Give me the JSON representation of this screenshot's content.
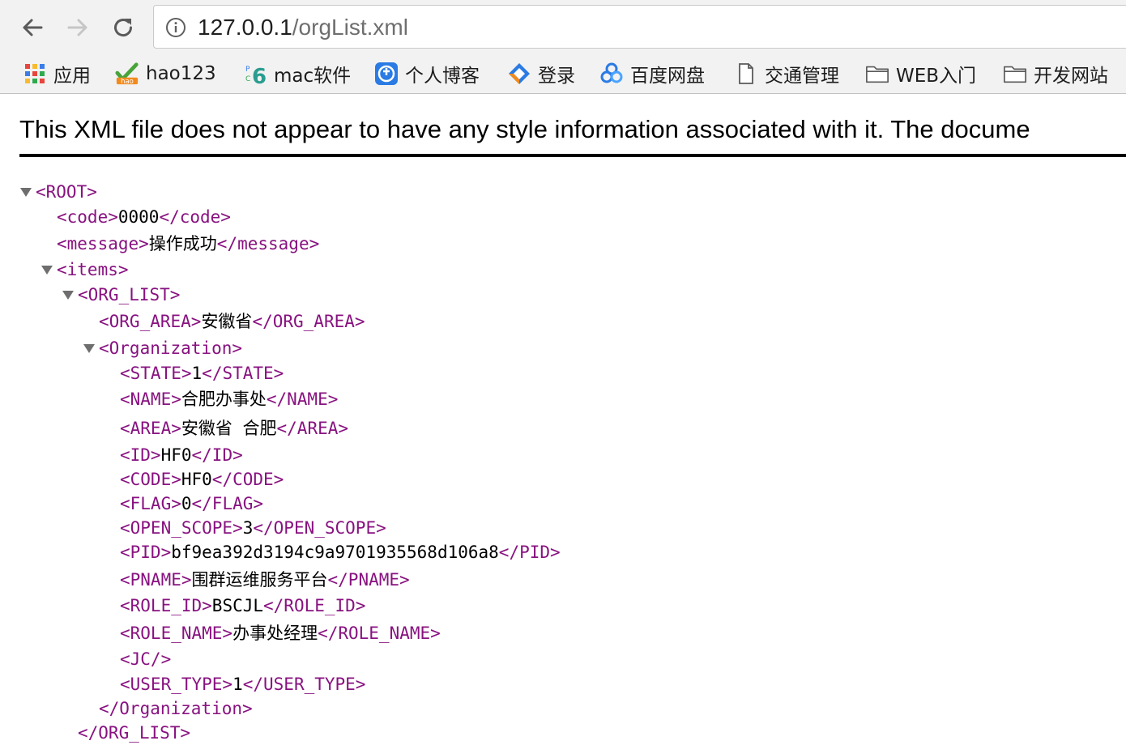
{
  "toolbar": {
    "back_icon": "arrow-left-icon",
    "forward_icon": "arrow-right-icon",
    "reload_icon": "reload-icon",
    "info_icon": "info-circle-icon",
    "url_host": "127.0.0.1",
    "url_path": "/orgList.xml"
  },
  "bookmarks": [
    {
      "label": "应用",
      "icon": "apps-grid-icon"
    },
    {
      "label": "hao123",
      "icon": "hao123-icon"
    },
    {
      "label": "mac软件",
      "icon": "mac-software-icon"
    },
    {
      "label": "个人博客",
      "icon": "blog-icon"
    },
    {
      "label": "登录",
      "icon": "login-icon"
    },
    {
      "label": "百度网盘",
      "icon": "baidu-pan-icon"
    },
    {
      "label": "交通管理",
      "icon": "document-icon"
    },
    {
      "label": "WEB入门",
      "icon": "folder-icon"
    },
    {
      "label": "开发网站",
      "icon": "folder-icon"
    }
  ],
  "notice": "This XML file does not appear to have any style information associated with it. The docume",
  "xml_lines": [
    {
      "open": "<ROOT>",
      "text": "",
      "close": "",
      "collapsible": true
    },
    {
      "open": "<code>",
      "text": "0000",
      "close": "</code>",
      "collapsible": false
    },
    {
      "open": "<message>",
      "text": "操作成功",
      "close": "</message>",
      "collapsible": false
    },
    {
      "open": "<items>",
      "text": "",
      "close": "",
      "collapsible": true
    },
    {
      "open": "<ORG_LIST>",
      "text": "",
      "close": "",
      "collapsible": true
    },
    {
      "open": "<ORG_AREA>",
      "text": "安徽省",
      "close": "</ORG_AREA>",
      "collapsible": false
    },
    {
      "open": "<Organization>",
      "text": "",
      "close": "",
      "collapsible": true
    },
    {
      "open": "<STATE>",
      "text": "1",
      "close": "</STATE>",
      "collapsible": false
    },
    {
      "open": "<NAME>",
      "text": "合肥办事处",
      "close": "</NAME>",
      "collapsible": false
    },
    {
      "open": "<AREA>",
      "text": "安徽省 合肥",
      "close": "</AREA>",
      "collapsible": false
    },
    {
      "open": "<ID>",
      "text": "HF0",
      "close": "</ID>",
      "collapsible": false
    },
    {
      "open": "<CODE>",
      "text": "HF0",
      "close": "</CODE>",
      "collapsible": false
    },
    {
      "open": "<FLAG>",
      "text": "0",
      "close": "</FLAG>",
      "collapsible": false
    },
    {
      "open": "<OPEN_SCOPE>",
      "text": "3",
      "close": "</OPEN_SCOPE>",
      "collapsible": false
    },
    {
      "open": "<PID>",
      "text": "bf9ea392d3194c9a9701935568d106a8",
      "close": "</PID>",
      "collapsible": false
    },
    {
      "open": "<PNAME>",
      "text": "围群运维服务平台",
      "close": "</PNAME>",
      "collapsible": false
    },
    {
      "open": "<ROLE_ID>",
      "text": "BSCJL",
      "close": "</ROLE_ID>",
      "collapsible": false
    },
    {
      "open": "<ROLE_NAME>",
      "text": "办事处经理",
      "close": "</ROLE_NAME>",
      "collapsible": false
    },
    {
      "open": "<JC/>",
      "text": "",
      "close": "",
      "collapsible": false
    },
    {
      "open": "<USER_TYPE>",
      "text": "1",
      "close": "</USER_TYPE>",
      "collapsible": false
    },
    {
      "open": "</Organization>",
      "text": "",
      "close": "",
      "collapsible": false
    },
    {
      "open": "</ORG_LIST>",
      "text": "",
      "close": "",
      "collapsible": false
    }
  ]
}
